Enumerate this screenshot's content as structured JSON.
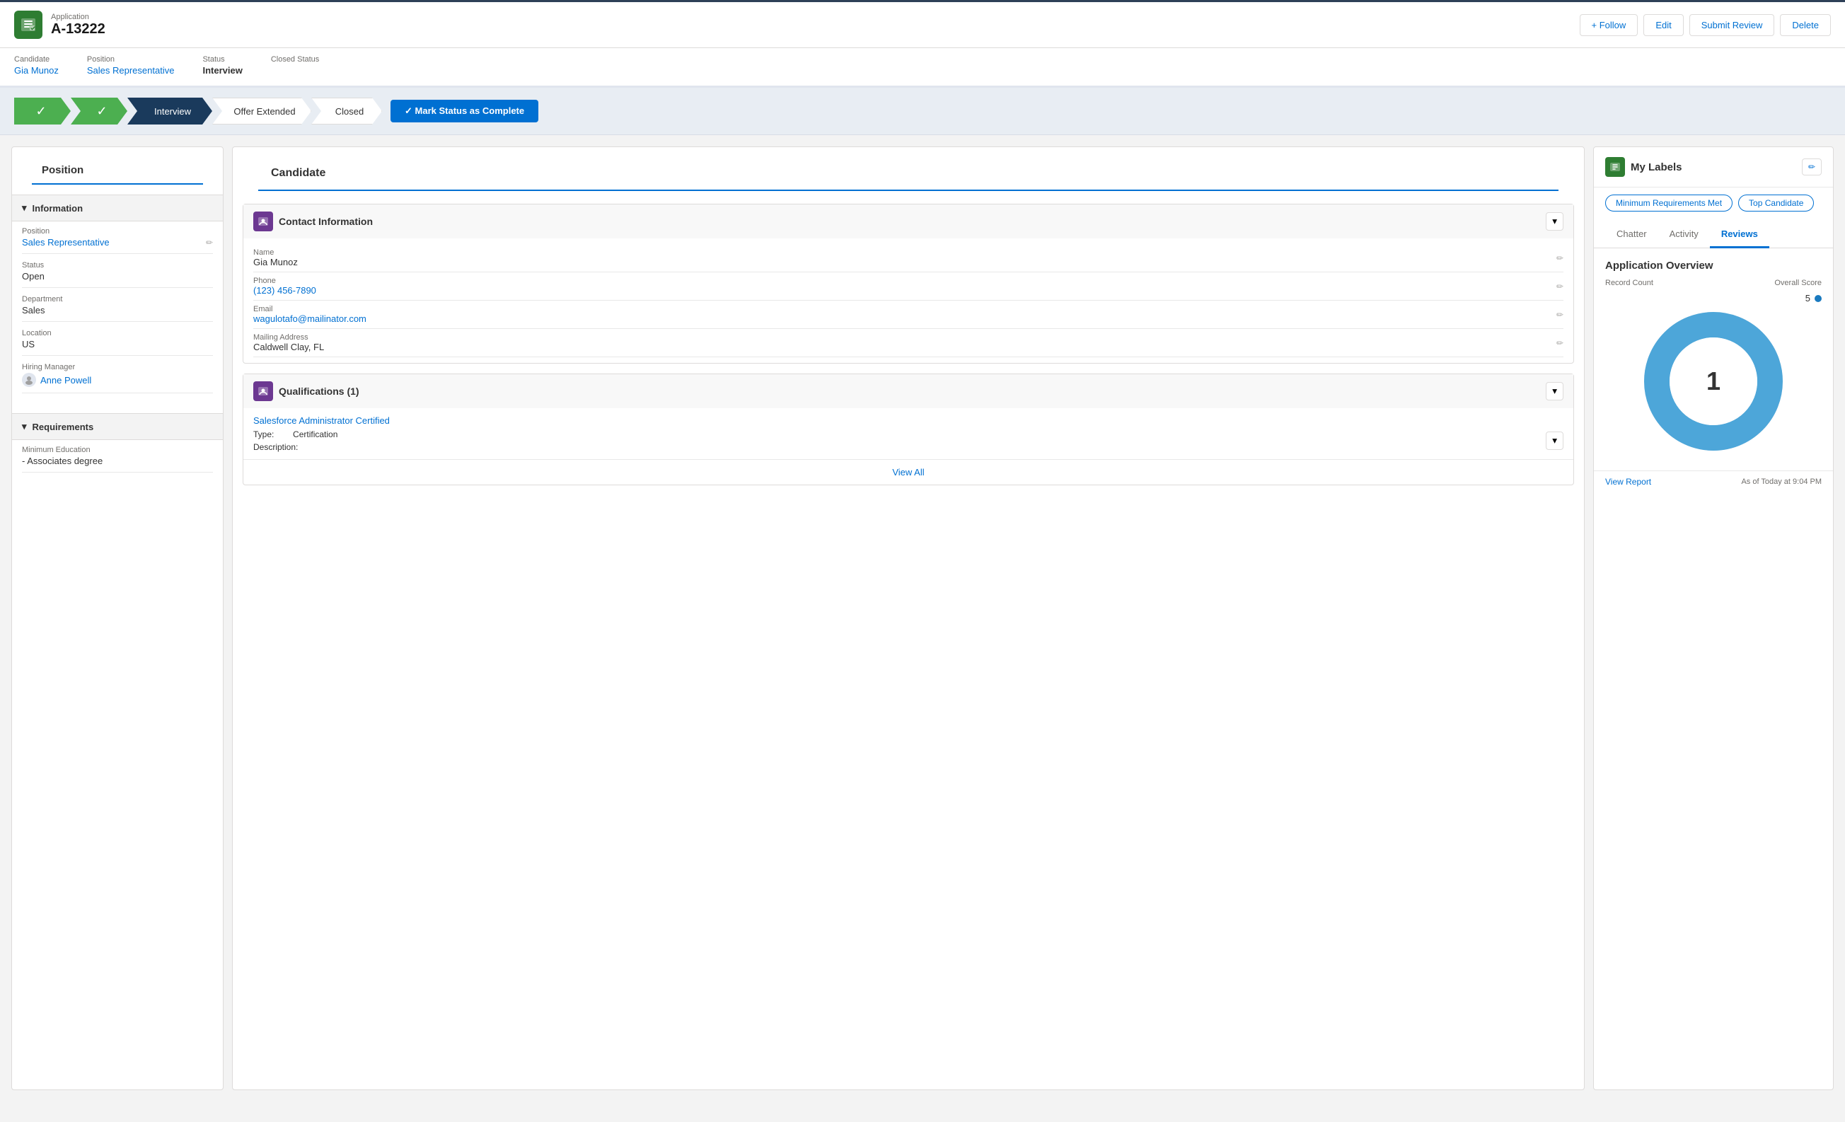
{
  "app": {
    "icon": "📋",
    "label": "Application",
    "id": "A-13222"
  },
  "header_buttons": {
    "follow": "+ Follow",
    "edit": "Edit",
    "submit_review": "Submit Review",
    "delete": "Delete"
  },
  "breadcrumb": {
    "candidate_label": "Candidate",
    "candidate_value": "Gia Munoz",
    "position_label": "Position",
    "position_value": "Sales Representative",
    "status_label": "Status",
    "status_value": "Interview",
    "closed_status_label": "Closed Status"
  },
  "stages": [
    {
      "label": "✓",
      "state": "complete"
    },
    {
      "label": "✓",
      "state": "complete"
    },
    {
      "label": "Interview",
      "state": "active"
    },
    {
      "label": "Offer Extended",
      "state": "inactive"
    },
    {
      "label": "Closed",
      "state": "inactive"
    }
  ],
  "mark_status_btn": "✓  Mark Status as Complete",
  "left_panel": {
    "title": "Position",
    "information_header": "Information",
    "fields": [
      {
        "label": "Position",
        "value": "Sales Representative",
        "is_link": true
      },
      {
        "label": "Status",
        "value": "Open",
        "is_link": false
      },
      {
        "label": "Department",
        "value": "Sales",
        "is_link": false
      },
      {
        "label": "Location",
        "value": "US",
        "is_link": false
      },
      {
        "label": "Hiring Manager",
        "value": "Anne Powell",
        "is_link": true
      }
    ],
    "requirements_header": "Requirements",
    "min_education_label": "Minimum Education",
    "min_education_value": "- Associates degree"
  },
  "mid_panel": {
    "title": "Candidate",
    "contact_info_title": "Contact Information",
    "contact_fields": [
      {
        "label": "Name",
        "value": "Gia Munoz",
        "is_link": false
      },
      {
        "label": "Phone",
        "value": "(123) 456-7890",
        "is_link": true
      },
      {
        "label": "Email",
        "value": "wagulotafo@mailinator.com",
        "is_link": true
      },
      {
        "label": "Mailing Address",
        "value": "Caldwell Clay, FL",
        "is_link": false
      }
    ],
    "qualifications_title": "Qualifications (1)",
    "qual_link": "Salesforce Administrator Certified",
    "qual_type": "Type:",
    "qual_type_value": "Certification",
    "qual_desc": "Description:",
    "view_all": "View All"
  },
  "right_panel": {
    "my_labels_title": "My Labels",
    "labels": [
      "Minimum Requirements Met",
      "Top Candidate"
    ],
    "tabs": [
      "Chatter",
      "Activity",
      "Reviews"
    ],
    "active_tab": "Reviews",
    "overview_title": "Application Overview",
    "record_count_label": "Record Count",
    "overall_score_label": "Overall Score",
    "overall_score_value": "5",
    "donut_center": "1",
    "view_report": "View Report",
    "timestamp": "As of Today at 9:04 PM"
  }
}
